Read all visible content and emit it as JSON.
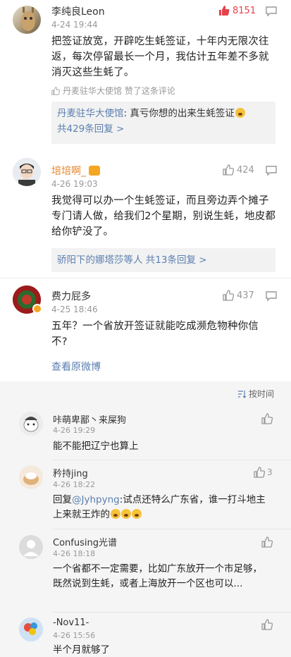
{
  "comments": [
    {
      "author": "李纯良Leon",
      "time": "4-24 19:44",
      "likes": "8151",
      "text": "把签证放宽，开辟吃生蚝签证，十年内无限次往返，每次停留最长一个月，我估计五年差不多就消灭这些生蚝了。",
      "liked_by": "丹麦驻华大使馆 赞了这条评论",
      "reply_preview_author": "丹麦驻华大使馆",
      "reply_preview_text": ": 真亏你想的出来生蚝签证",
      "reply_count": "共429条回复 >"
    },
    {
      "author": "培培啊_",
      "time": "4-26 19:03",
      "likes": "424",
      "text": "我觉得可以办一个生蚝签证，而且旁边弄个摊子专门请人做，给我们2个星期，别说生蚝，地皮都给你铲没了。",
      "reply_summary": "骄阳下的娜塔莎等人  共13条回复 >"
    },
    {
      "author": "费力屁多",
      "time": "4-25 18:46",
      "likes": "437",
      "text": "五年？一个省放开签证就能吃成濒危物种你信不?",
      "view_original": "查看原微博"
    }
  ],
  "sort_label": "按时间",
  "replies": [
    {
      "author": "咔萌卑鄙丶来屎狗",
      "time": "4-26 19:29",
      "likes": "",
      "text": "能不能把辽宁也算上"
    },
    {
      "author": "矜持jing",
      "time": "4-26 18:22",
      "likes": "3",
      "text_prefix": "回复",
      "mention": "@Jyhpyng",
      "text": ":试点还特么广东省，谁一打斗地主上来就王炸的"
    },
    {
      "author": "Confusing光谱",
      "time": "4-26 18:18",
      "likes": "",
      "text": "一个省都不一定需要，比如广东放开一个市足够，既然说到生蚝，或者上海放开一个区也可以..."
    },
    {
      "author": "-Nov11-",
      "time": "4-26 15:56",
      "likes": "",
      "text": "半个月就够了"
    }
  ],
  "colors": {
    "hot_like": "#e6424c",
    "link": "#5b7fb0",
    "muted": "#999999"
  }
}
